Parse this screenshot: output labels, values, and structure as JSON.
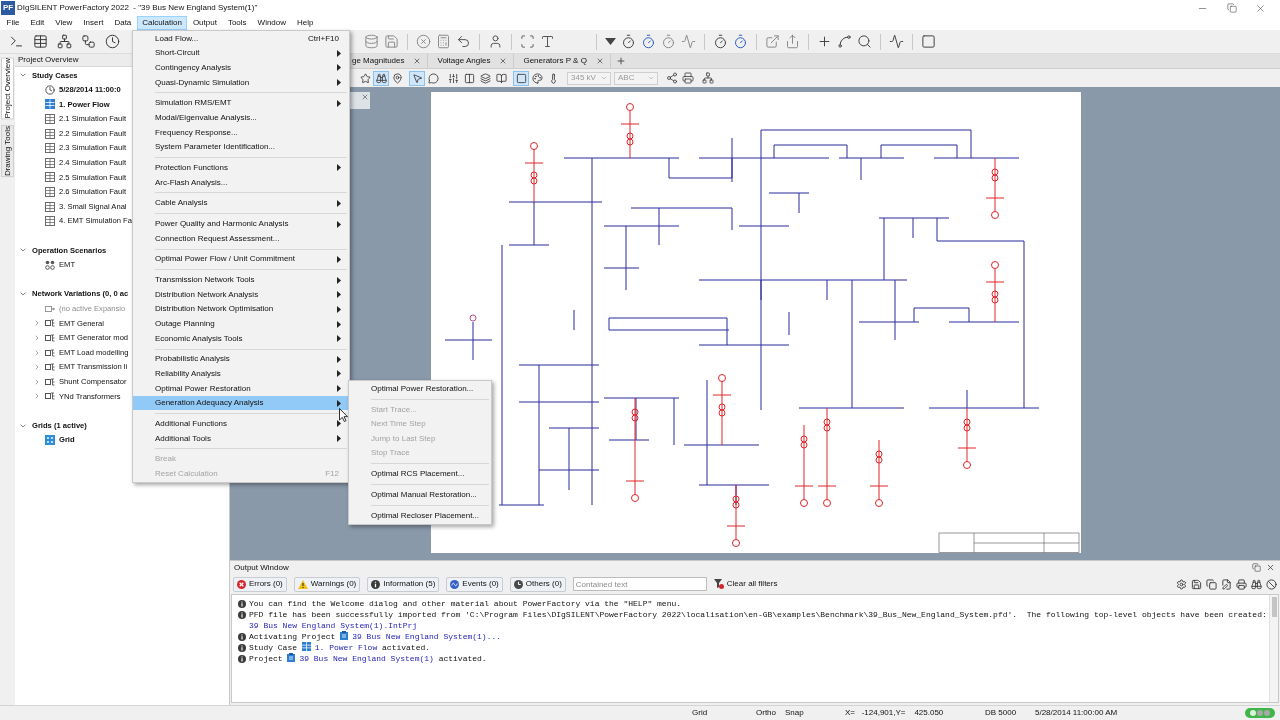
{
  "window": {
    "logo": "PF",
    "title": "DIgSILENT PowerFactory 2022  - \"39 Bus New England System(1)\""
  },
  "menu_bar": [
    {
      "label": "File",
      "selected": false
    },
    {
      "label": "Edit",
      "selected": false
    },
    {
      "label": "View",
      "selected": false
    },
    {
      "label": "Insert",
      "selected": false
    },
    {
      "label": "Data",
      "selected": false
    },
    {
      "label": "Calculation",
      "selected": true
    },
    {
      "label": "Output",
      "selected": false
    },
    {
      "label": "Tools",
      "selected": false
    },
    {
      "label": "Window",
      "selected": false
    },
    {
      "label": "Help",
      "selected": false
    }
  ],
  "calculation_menu": {
    "groups": [
      [
        {
          "label": "Load Flow...",
          "shortcut": "Ctrl+F10",
          "submenu": false,
          "disabled": false,
          "selected": false
        },
        {
          "label": "Short-Circuit",
          "submenu": true,
          "disabled": false,
          "selected": false
        },
        {
          "label": "Contingency Analysis",
          "submenu": true,
          "disabled": false,
          "selected": false
        },
        {
          "label": "Quasi-Dynamic Simulation",
          "submenu": true,
          "disabled": false,
          "selected": false
        }
      ],
      [
        {
          "label": "Simulation RMS/EMT",
          "submenu": true,
          "disabled": false,
          "selected": false
        },
        {
          "label": "Modal/Eigenvalue Analysis...",
          "submenu": false,
          "disabled": false,
          "selected": false
        },
        {
          "label": "Frequency Response...",
          "submenu": false,
          "disabled": false,
          "selected": false
        },
        {
          "label": "System Parameter Identification...",
          "submenu": false,
          "disabled": false,
          "selected": false
        }
      ],
      [
        {
          "label": "Protection Functions",
          "submenu": true,
          "disabled": false,
          "selected": false
        },
        {
          "label": "Arc-Flash Analysis...",
          "submenu": false,
          "disabled": false,
          "selected": false
        }
      ],
      [
        {
          "label": "Cable Analysis",
          "submenu": true,
          "disabled": false,
          "selected": false
        }
      ],
      [
        {
          "label": "Power Quality and Harmonic Analysis",
          "submenu": true,
          "disabled": false,
          "selected": false
        },
        {
          "label": "Connection Request Assessment...",
          "submenu": false,
          "disabled": false,
          "selected": false
        }
      ],
      [
        {
          "label": "Optimal Power Flow / Unit Commitment",
          "submenu": true,
          "disabled": false,
          "selected": false
        }
      ],
      [
        {
          "label": "Transmission Network Tools",
          "submenu": true,
          "disabled": false,
          "selected": false
        },
        {
          "label": "Distribution Network Analysis",
          "submenu": true,
          "disabled": false,
          "selected": false
        },
        {
          "label": "Distribution Network Optimisation",
          "submenu": true,
          "disabled": false,
          "selected": false
        },
        {
          "label": "Outage Planning",
          "submenu": true,
          "disabled": false,
          "selected": false
        },
        {
          "label": "Economic Analysis Tools",
          "submenu": true,
          "disabled": false,
          "selected": false
        }
      ],
      [
        {
          "label": "Probabilistic Analysis",
          "submenu": true,
          "disabled": false,
          "selected": false
        },
        {
          "label": "Reliability Analysis",
          "submenu": true,
          "disabled": false,
          "selected": false
        },
        {
          "label": "Optimal Power Restoration",
          "submenu": true,
          "disabled": false,
          "selected": false
        },
        {
          "label": "Generation Adequacy Analysis",
          "submenu": true,
          "disabled": false,
          "selected": true
        }
      ],
      [
        {
          "label": "Additional Functions",
          "submenu": true,
          "disabled": false,
          "selected": false
        },
        {
          "label": "Additional Tools",
          "submenu": true,
          "disabled": false,
          "selected": false
        }
      ],
      [
        {
          "label": "Break",
          "submenu": false,
          "disabled": true,
          "selected": false
        },
        {
          "label": "Reset Calculation",
          "shortcut": "F12",
          "submenu": false,
          "disabled": true,
          "selected": false
        }
      ]
    ]
  },
  "submenu": {
    "groups": [
      [
        {
          "label": "Optimal Power Restoration...",
          "disabled": false,
          "selected": false
        }
      ],
      [
        {
          "label": "Start Trace...",
          "disabled": true,
          "selected": false
        },
        {
          "label": "Next Time Step",
          "disabled": true,
          "selected": false
        },
        {
          "label": "Jump to Last Step",
          "disabled": true,
          "selected": false
        },
        {
          "label": "Stop Trace",
          "disabled": true,
          "selected": false
        }
      ],
      [
        {
          "label": "Optimal RCS Placement...",
          "disabled": false,
          "selected": false
        }
      ],
      [
        {
          "label": "Optimal Manual Restoration...",
          "disabled": false,
          "selected": false
        }
      ],
      [
        {
          "label": "Optimal Recloser Placement...",
          "disabled": false,
          "selected": false
        }
      ]
    ]
  },
  "side_tabs": [
    {
      "label": "Project Overview",
      "selected": true
    },
    {
      "label": "Drawing Tools",
      "selected": false
    }
  ],
  "project_overview": {
    "title": "Project Overview",
    "tree": [
      {
        "label": "Study Cases",
        "expanded": true,
        "children": [
          {
            "label": "5/28/2014 11:00:0",
            "kind": "time"
          },
          {
            "label": "1. Power Flow",
            "kind": "study_case",
            "active": true
          },
          {
            "label": "2.1 Simulation Fault",
            "kind": "study_case",
            "active": false
          },
          {
            "label": "2.2 Simulation Fault",
            "kind": "study_case",
            "active": false
          },
          {
            "label": "2.3 Simulation Fault",
            "kind": "study_case",
            "active": false
          },
          {
            "label": "2.4 Simulation Fault",
            "kind": "study_case",
            "active": false
          },
          {
            "label": "2.5 Simulation Fault",
            "kind": "study_case",
            "active": false
          },
          {
            "label": "2.6 Simulation Fault",
            "kind": "study_case",
            "active": false
          },
          {
            "label": "3. Small Signal Anal",
            "kind": "study_case",
            "active": false
          },
          {
            "label": "4. EMT Simulation Fa",
            "kind": "study_case",
            "active": false
          }
        ]
      },
      {
        "label": "Operation Scenarios",
        "expanded": true,
        "children": [
          {
            "label": "EMT",
            "kind": "scenario"
          }
        ]
      },
      {
        "label": "Network Variations (0, 0 ac",
        "expanded": true,
        "children": [
          {
            "label": "(no active Expansio",
            "kind": "expansion"
          },
          {
            "label": "EMT General",
            "kind": "variation",
            "expanded": false
          },
          {
            "label": "EMT Generator mod",
            "kind": "variation",
            "expanded": false
          },
          {
            "label": "EMT Load modelling",
            "kind": "variation",
            "expanded": false
          },
          {
            "label": "EMT Transmission li",
            "kind": "variation",
            "expanded": false
          },
          {
            "label": "Shunt Compensator",
            "kind": "variation",
            "expanded": false
          },
          {
            "label": "YNd Transformers",
            "kind": "variation",
            "expanded": false
          }
        ]
      },
      {
        "label": "Grids (1 active)",
        "expanded": true,
        "children": [
          {
            "label": "Grid",
            "kind": "grid",
            "active": true
          }
        ]
      }
    ]
  },
  "diagram_tabs": [
    {
      "label": "ge Magnitudes",
      "selected": false
    },
    {
      "label": "Voltage Angles",
      "selected": false
    },
    {
      "label": "Generators P & Q",
      "selected": false
    }
  ],
  "diagram_toolbar": {
    "tools": [
      {
        "on": false
      },
      {
        "on": true
      },
      {
        "on": false
      },
      {
        "on": true
      },
      {
        "on": false
      },
      {
        "on": false
      },
      {
        "on": false
      },
      {
        "on": false
      },
      {
        "on": false
      },
      {
        "on": true
      },
      {
        "on": false
      },
      {
        "on": false
      }
    ],
    "voltage_combo": {
      "value": "345 kV",
      "disabled": true
    },
    "text_combo": {
      "value": "ABC",
      "disabled": true
    }
  },
  "output_window": {
    "title": "Output Window",
    "filters": [
      {
        "kind": "errors",
        "label": "Errors (0)"
      },
      {
        "kind": "warnings",
        "label": "Warnings (0)"
      },
      {
        "kind": "information",
        "label": "Information (5)"
      },
      {
        "kind": "events",
        "label": "Events (0)"
      },
      {
        "kind": "others",
        "label": "Others (0)"
      }
    ],
    "search": {
      "placeholder": "Contained text"
    },
    "clear_filters": "Clear all filters",
    "messages": [
      {
        "lines": [
          [
            {
              "kind": "text",
              "text": "You can find the Welcome dialog and other material about PowerFactory via the \"HELP\" menu."
            }
          ]
        ]
      },
      {
        "lines": [
          [
            {
              "kind": "text",
              "text": "PFD file has been successfully imported from 'C:\\Program Files\\DIgSILENT\\PowerFactory 2022\\localisation\\en-GB\\examples\\Benchmark\\39_Bus_New_England_System.pfd'.  The following top-level objects have been created:"
            }
          ],
          [
            {
              "kind": "link",
              "text": "39 Bus New England System(1).IntPrj"
            }
          ]
        ]
      },
      {
        "lines": [
          [
            {
              "kind": "text",
              "text": "Activating Project "
            },
            {
              "kind": "project_link",
              "text": "39 Bus New England System(1)..."
            }
          ]
        ]
      },
      {
        "lines": [
          [
            {
              "kind": "text",
              "text": "Study Case "
            },
            {
              "kind": "case_link",
              "text": "1. Power Flow"
            },
            {
              "kind": "text",
              "text": " activated."
            }
          ]
        ]
      },
      {
        "lines": [
          [
            {
              "kind": "text",
              "text": "Project "
            },
            {
              "kind": "project_link",
              "text": "39 Bus New England System(1)"
            },
            {
              "kind": "text",
              "text": " activated."
            }
          ]
        ]
      }
    ]
  },
  "status_bar": [
    "Grid",
    "Ortho",
    "Snap",
    "X=   -124,901,Y=    425.050",
    "DB 5000",
    "5/28/2014 11:00:00 AM"
  ]
}
